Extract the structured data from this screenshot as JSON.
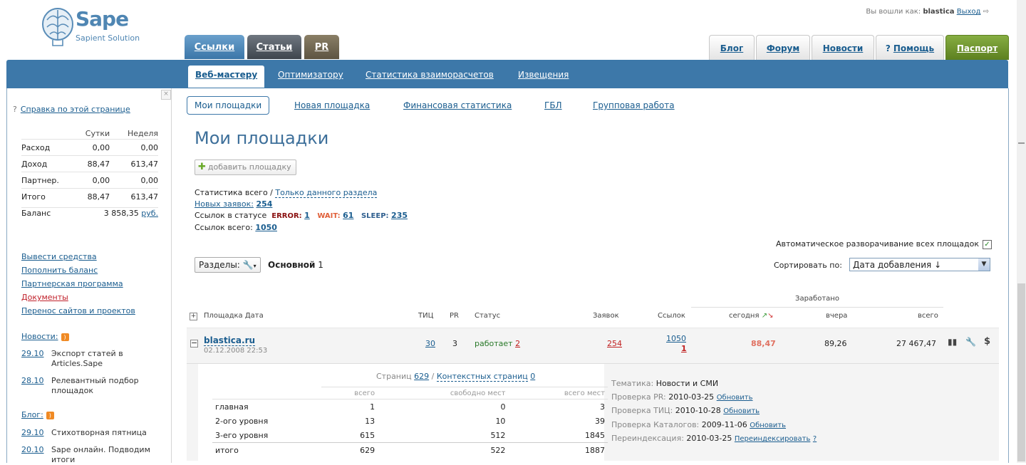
{
  "header": {
    "logo_title": "Sape",
    "logo_sub": "Sapient Solution",
    "login_prefix": "Вы вошли как:",
    "login_user": "blastica",
    "logout": "Выход"
  },
  "top_tabs": [
    "Ссылки",
    "Статьи",
    "PR"
  ],
  "right_tabs": [
    "Блог",
    "Форум",
    "Новости",
    "Помощь",
    "Паспорт"
  ],
  "sub_tabs": [
    "Веб-мастеру",
    "Оптимизатору",
    "Статистика взаиморасчетов",
    "Извещения"
  ],
  "third_tabs": [
    "Мои площадки",
    "Новая площадка",
    "Финансовая статистика",
    "ГБЛ",
    "Групповая работа"
  ],
  "sidebar": {
    "help": "Справка по этой странице",
    "col_day": "Сутки",
    "col_week": "Неделя",
    "rows": [
      {
        "label": "Расход",
        "day": "0,00",
        "week": "0,00"
      },
      {
        "label": "Доход",
        "day": "88,47",
        "week": "613,47"
      },
      {
        "label": "Партнер.",
        "day": "0,00",
        "week": "0,00"
      },
      {
        "label": "Итого",
        "day": "88,47",
        "week": "613,47"
      }
    ],
    "balance_label": "Баланс",
    "balance_value": "3 858,35",
    "balance_currency": "руб.",
    "links": [
      "Вывести средства",
      "Пополнить баланс",
      "Партнерская программа",
      "Документы",
      "Перенос сайтов и проектов"
    ],
    "news_title": "Новости:",
    "news": [
      {
        "date": "29.10",
        "text": "Экспорт статей в Articles.Sape"
      },
      {
        "date": "28.10",
        "text": "Релевантный подбор площадок"
      }
    ],
    "blog_title": "Блог:",
    "blog": [
      {
        "date": "29.10",
        "text": "Стихотворная пятница"
      },
      {
        "date": "20.10",
        "text": "Sape онлайн. Подводим итоги"
      }
    ]
  },
  "main": {
    "title": "Мои площадки",
    "add_button": "добавить площадку",
    "stats_total": "Статистика всего /",
    "stats_section": "Только данного раздела",
    "new_requests_label": "Новых заявок:",
    "new_requests_value": "254",
    "status_label": "Ссылок в статусе",
    "error_label": "ERROR:",
    "error_value": "1",
    "wait_label": "WAIT:",
    "wait_value": "61",
    "sleep_label": "SLEEP:",
    "sleep_value": "235",
    "links_total_label": "Ссылок всего:",
    "links_total_value": "1050",
    "auto_expand": "Автоматическое разворачивание всех площадок",
    "sections_btn": "Разделы:",
    "main_section": "Основной",
    "main_section_count": "1",
    "sort_label": "Сортировать по:",
    "sort_value": "Дата добавления ↓"
  },
  "table": {
    "earned": "Заработано",
    "headers": {
      "site": "Площадка",
      "date": "Дата",
      "tic": "ТИЦ",
      "pr": "PR",
      "status": "Статус",
      "requests": "Заявок",
      "links": "Ссылок",
      "today": "сегодня",
      "yesterday": "вчера",
      "total": "всего"
    },
    "site": {
      "name": "blastica.ru",
      "date": "02.12.2008 22:53",
      "tic": "30",
      "pr": "3",
      "status": "работает",
      "status_count": "2",
      "requests": "254",
      "links": "1050",
      "links_error": "1",
      "today": "88,47",
      "yesterday": "89,26",
      "total": "27 467,47"
    },
    "detail": {
      "pages_label": "Страниц",
      "pages_value": "629",
      "context_label": "Контекстных страниц",
      "context_value": "0",
      "cols": [
        "всего",
        "свободно мест",
        "всего мест"
      ],
      "rows": [
        {
          "label": "главная",
          "total": "1",
          "free": "0",
          "places": "3"
        },
        {
          "label": "2-ого уровня",
          "total": "13",
          "free": "10",
          "places": "39"
        },
        {
          "label": "3-его уровня",
          "total": "615",
          "free": "512",
          "places": "1845"
        },
        {
          "label": "итого",
          "total": "629",
          "free": "522",
          "places": "1887"
        }
      ],
      "theme_label": "Тематика:",
      "theme_value": "Новости и СМИ",
      "pr_check_label": "Проверка PR:",
      "pr_check_date": "2010-03-25",
      "tic_check_label": "Проверка ТИЦ:",
      "tic_check_date": "2010-10-28",
      "cat_check_label": "Проверка Каталогов:",
      "cat_check_date": "2009-11-06",
      "update": "Обновить",
      "reindex_label": "Переиндексация:",
      "reindex_date": "2010-03-25",
      "reindex_link": "Переиндексировать",
      "reindex_help": "?"
    }
  }
}
